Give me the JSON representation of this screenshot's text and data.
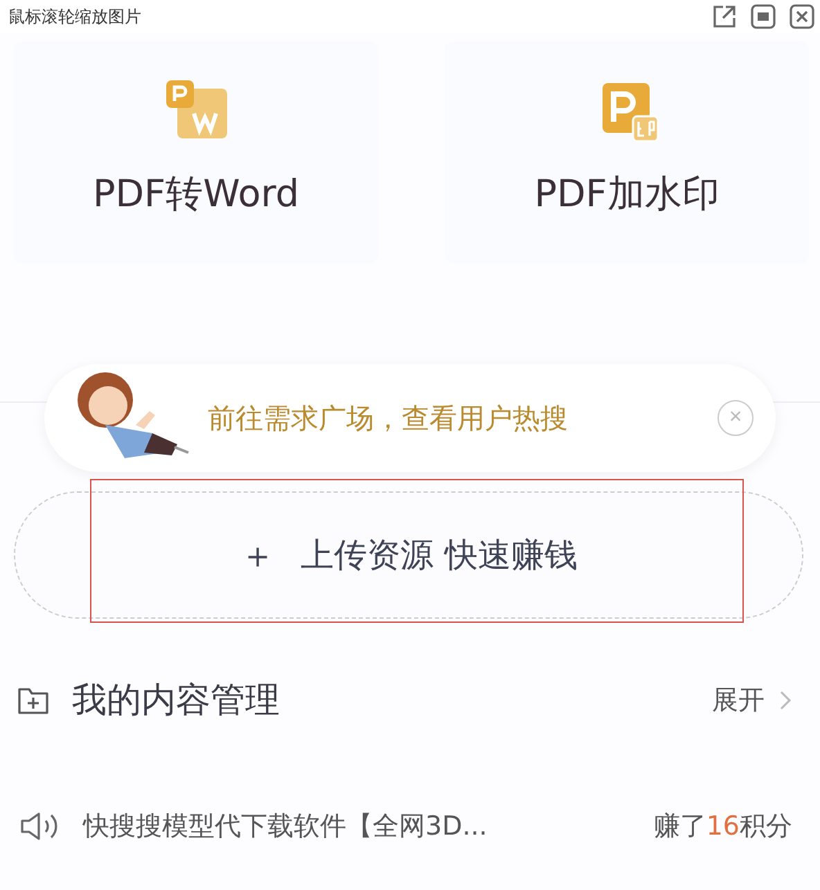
{
  "window": {
    "title": "鼠标滚轮缩放图片"
  },
  "tools": [
    {
      "kind": "word",
      "label": "PDF转Word"
    },
    {
      "kind": "stamp",
      "label": "PDF加水印"
    }
  ],
  "prompt": {
    "text": "前往需求广场，查看用户热搜",
    "close": "×"
  },
  "upload": {
    "plus": "＋",
    "label": "上传资源 快速赚钱",
    "highlighted": true
  },
  "content_manager": {
    "title": "我的内容管理",
    "action": "展开"
  },
  "notice": {
    "text": "快搜搜模型代下载软件【全网3D...",
    "prefix": "赚了",
    "amount": "16",
    "suffix": "积分"
  }
}
